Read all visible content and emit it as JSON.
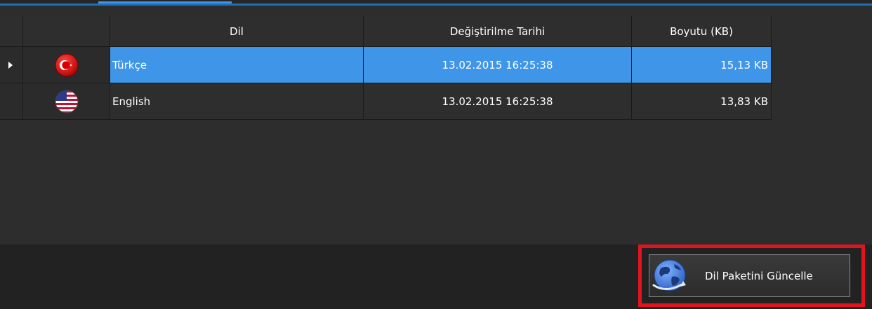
{
  "grid": {
    "columns": {
      "dil": "Dil",
      "date": "Değiştirilme Tarihi",
      "size": "Boyutu (KB)"
    },
    "rows": [
      {
        "language": "Türkçe",
        "modified": "13.02.2015 16:25:38",
        "size": "15,13 KB",
        "flag_icon": "turkey-flag-icon",
        "selected": true
      },
      {
        "language": "English",
        "modified": "13.02.2015 16:25:38",
        "size": "13,83 KB",
        "flag_icon": "usa-flag-icon",
        "selected": false
      }
    ]
  },
  "toolbar": {
    "update_label": "Dil Paketini Güncelle",
    "update_icon": "globe-update-icon"
  },
  "colors": {
    "selection": "#3f95e8",
    "highlight": "#e0131f",
    "accent_line": "#1d6fb8"
  }
}
